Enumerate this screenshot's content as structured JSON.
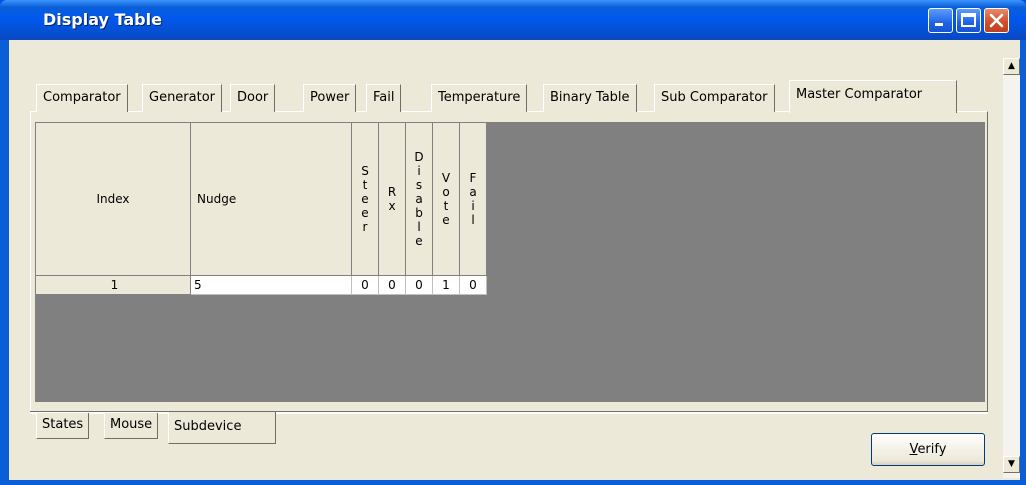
{
  "window": {
    "title": "Display Table",
    "minimize_label": "",
    "maximize_label": "",
    "close_label": ""
  },
  "top_tabs": [
    {
      "label": "Comparator",
      "active": false
    },
    {
      "label": "Generator",
      "active": false
    },
    {
      "label": "Door",
      "active": false
    },
    {
      "label": "Power",
      "active": false
    },
    {
      "label": "Fail",
      "active": false
    },
    {
      "label": "Temperature",
      "active": false
    },
    {
      "label": "Binary Table",
      "active": false
    },
    {
      "label": "Sub Comparator",
      "active": false
    },
    {
      "label": "Master Comparator",
      "active": true
    }
  ],
  "table": {
    "columns": [
      "Index",
      "Nudge",
      "Steer",
      "Rx",
      "Disable",
      "Vote",
      "Fail"
    ],
    "rows": [
      {
        "index": "1",
        "nudge": "5",
        "steer": "0",
        "rx": "0",
        "disable": "0",
        "vote": "1",
        "fail": "0"
      }
    ]
  },
  "bottom_tabs": [
    {
      "label": "States",
      "active": false
    },
    {
      "label": "Mouse",
      "active": false
    },
    {
      "label": "Subdevice",
      "active": true
    }
  ],
  "verify_button": {
    "label": "Verify",
    "mnemonic": "V"
  },
  "colors": {
    "titlebar": "#0058ee",
    "close_button": "#d0502d",
    "grid_background": "#808080",
    "dialog_face": "#ece9d8"
  }
}
